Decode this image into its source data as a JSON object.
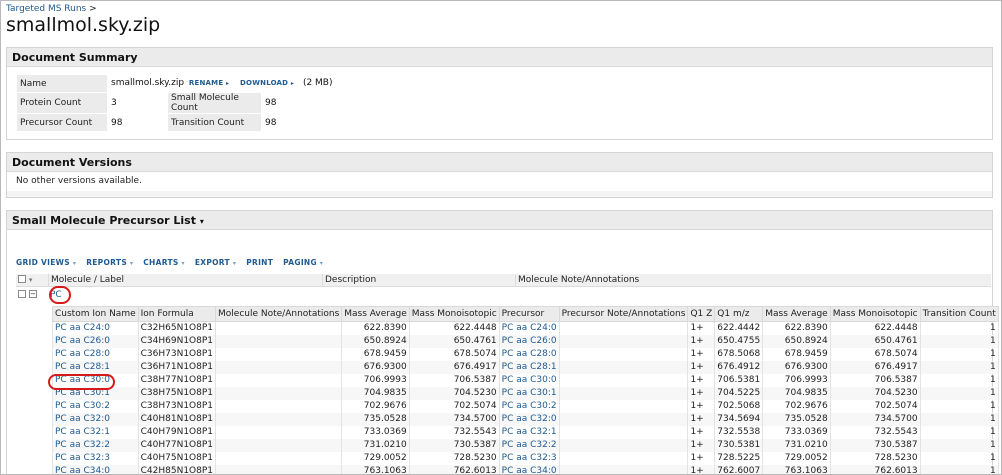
{
  "breadcrumb": {
    "link": "Targeted MS Runs",
    "sep": ">"
  },
  "title": "smallmol.sky.zip",
  "summary": {
    "heading": "Document Summary",
    "name_label": "Name",
    "name_value": "smallmol.sky.zip",
    "rename": "RENAME",
    "download": "DOWNLOAD",
    "size": "(2 MB)",
    "protein_count_label": "Protein Count",
    "protein_count": "3",
    "small_molecule_count_label": "Small Molecule Count",
    "small_molecule_count": "98",
    "precursor_count_label": "Precursor Count",
    "precursor_count": "98",
    "transition_count_label": "Transition Count",
    "transition_count": "98"
  },
  "versions": {
    "heading": "Document Versions",
    "text": "No other versions available."
  },
  "precursor_list": {
    "heading": "Small Molecule Precursor List",
    "toolbar": [
      "GRID VIEWS",
      "REPORTS",
      "CHARTS",
      "EXPORT",
      "PRINT",
      "PAGING"
    ],
    "columns": [
      "Molecule / Label",
      "Description",
      "Molecule Note/Annotations"
    ],
    "group": "PC",
    "sub_columns": [
      "Custom Ion Name",
      "Ion Formula",
      "Molecule Note/Annotations",
      "Mass Average",
      "Mass Monoisotopic",
      "Precursor",
      "Precursor Note/Annotations",
      "Q1 Z",
      "Q1 m/z",
      "Mass Average",
      "Mass Monoisotopic",
      "Transition Count"
    ],
    "rows": [
      [
        "PC aa C24:0",
        "C32H65N1O8P1",
        "",
        "622.8390",
        "622.4448",
        "PC aa C24:0",
        "",
        "1+",
        "622.4442",
        "622.8390",
        "622.4448",
        "1"
      ],
      [
        "PC aa C26:0",
        "C34H69N1O8P1",
        "",
        "650.8924",
        "650.4761",
        "PC aa C26:0",
        "",
        "1+",
        "650.4755",
        "650.8924",
        "650.4761",
        "1"
      ],
      [
        "PC aa C28:0",
        "C36H73N1O8P1",
        "",
        "678.9459",
        "678.5074",
        "PC aa C28:0",
        "",
        "1+",
        "678.5068",
        "678.9459",
        "678.5074",
        "1"
      ],
      [
        "PC aa C28:1",
        "C36H71N1O8P1",
        "",
        "676.9300",
        "676.4917",
        "PC aa C28:1",
        "",
        "1+",
        "676.4912",
        "676.9300",
        "676.4917",
        "1"
      ],
      [
        "PC aa C30:0",
        "C38H77N1O8P1",
        "",
        "706.9993",
        "706.5387",
        "PC aa C30:0",
        "",
        "1+",
        "706.5381",
        "706.9993",
        "706.5387",
        "1"
      ],
      [
        "PC aa C30:1",
        "C38H75N1O8P1",
        "",
        "704.9835",
        "704.5230",
        "PC aa C30:1",
        "",
        "1+",
        "704.5225",
        "704.9835",
        "704.5230",
        "1"
      ],
      [
        "PC aa C30:2",
        "C38H73N1O8P1",
        "",
        "702.9676",
        "702.5074",
        "PC aa C30:2",
        "",
        "1+",
        "702.5068",
        "702.9676",
        "702.5074",
        "1"
      ],
      [
        "PC aa C32:0",
        "C40H81N1O8P1",
        "",
        "735.0528",
        "734.5700",
        "PC aa C32:0",
        "",
        "1+",
        "734.5694",
        "735.0528",
        "734.5700",
        "1"
      ],
      [
        "PC aa C32:1",
        "C40H79N1O8P1",
        "",
        "733.0369",
        "732.5543",
        "PC aa C32:1",
        "",
        "1+",
        "732.5538",
        "733.0369",
        "732.5543",
        "1"
      ],
      [
        "PC aa C32:2",
        "C40H77N1O8P1",
        "",
        "731.0210",
        "730.5387",
        "PC aa C32:2",
        "",
        "1+",
        "730.5381",
        "731.0210",
        "730.5387",
        "1"
      ],
      [
        "PC aa C32:3",
        "C40H75N1O8P1",
        "",
        "729.0052",
        "728.5230",
        "PC aa C32:3",
        "",
        "1+",
        "728.5225",
        "729.0052",
        "728.5230",
        "1"
      ],
      [
        "PC aa C34:0",
        "C42H85N1O8P1",
        "",
        "763.1063",
        "762.6013",
        "PC aa C34:0",
        "",
        "1+",
        "762.6007",
        "763.1063",
        "762.6013",
        "1"
      ]
    ]
  },
  "colors": {
    "link": "#1f5a90",
    "highlight_circle": "#d61a1a"
  }
}
